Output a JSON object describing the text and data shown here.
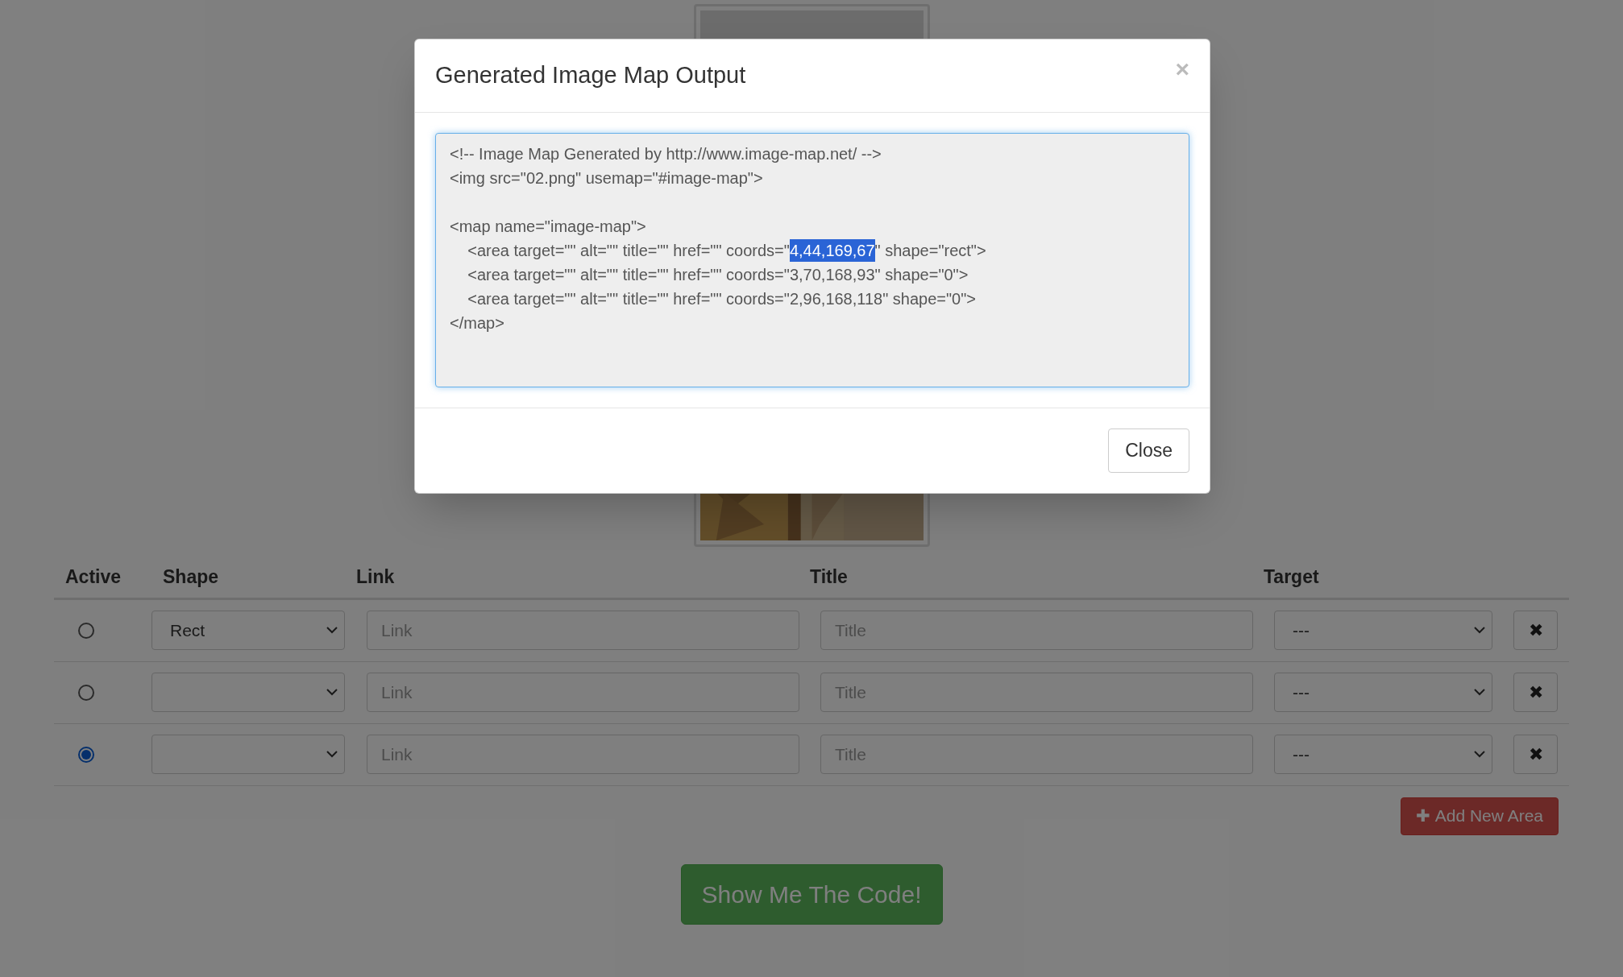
{
  "modal": {
    "title": "Generated Image Map Output",
    "close_symbol": "×",
    "code_lines": [
      {
        "kind": "text",
        "segments": [
          {
            "text": "<!-- Image Map Generated by http://www.image-map.net/ -->",
            "selected": false
          }
        ]
      },
      {
        "kind": "text",
        "segments": [
          {
            "text": "<img src=\"02.png\" usemap=\"#image-map\">",
            "selected": false
          }
        ]
      },
      {
        "kind": "blank"
      },
      {
        "kind": "text",
        "segments": [
          {
            "text": "<map name=\"image-map\">",
            "selected": false
          }
        ]
      },
      {
        "kind": "text",
        "segments": [
          {
            "text": "    <area target=\"\" alt=\"\" title=\"\" href=\"\" coords=\"",
            "selected": false
          },
          {
            "text": "4,44,169,67",
            "selected": true
          },
          {
            "text": "\" shape=\"rect\">",
            "selected": false
          }
        ]
      },
      {
        "kind": "text",
        "segments": [
          {
            "text": "    <area target=\"\" alt=\"\" title=\"\" href=\"\" coords=\"3,70,168,93\" shape=\"0\">",
            "selected": false
          }
        ]
      },
      {
        "kind": "text",
        "segments": [
          {
            "text": "    <area target=\"\" alt=\"\" title=\"\" href=\"\" coords=\"2,96,168,118\" shape=\"0\">",
            "selected": false
          }
        ]
      },
      {
        "kind": "text",
        "segments": [
          {
            "text": "</map>",
            "selected": false
          }
        ]
      }
    ],
    "close_button": "Close"
  },
  "table": {
    "columns": [
      "Active",
      "Shape",
      "Link",
      "Title",
      "Target"
    ],
    "rows": [
      {
        "selected": false,
        "shape": "Rect",
        "link_placeholder": "Link",
        "title_placeholder": "Title",
        "target": "---",
        "delete_symbol": "✖"
      },
      {
        "selected": false,
        "link_placeholder": "Link",
        "title_placeholder": "Title",
        "target": "---",
        "delete_symbol": "✖"
      },
      {
        "selected": true,
        "link_placeholder": "Link",
        "title_placeholder": "Title",
        "target": "---",
        "delete_symbol": "✖"
      }
    ]
  },
  "add_button": {
    "icon": "✚",
    "label": "Add New Area"
  },
  "show_code_button": "Show Me The Code!"
}
